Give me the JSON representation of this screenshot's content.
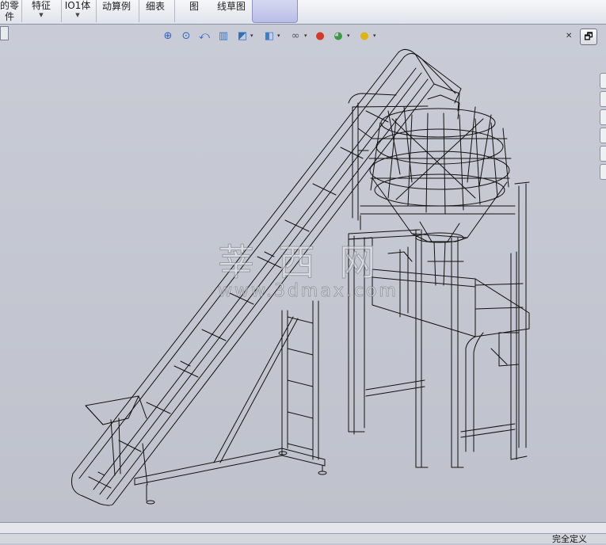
{
  "ribbon": {
    "items": [
      {
        "line1": "的零",
        "line2": "件",
        "dropdown": false
      },
      {
        "line1": "特征",
        "line2": "",
        "dropdown": true
      },
      {
        "line1": "IO1体",
        "line2": "",
        "dropdown": true
      },
      {
        "line1": "动算例",
        "line2": "",
        "dropdown": false
      },
      {
        "line1": "细表",
        "line2": "",
        "dropdown": false
      },
      {
        "line1": "图",
        "line2": "",
        "dropdown": false
      },
      {
        "line1": "线草图",
        "line2": "",
        "dropdown": false
      }
    ],
    "dropdown_glyph": "▼"
  },
  "hud_toolbar": {
    "icons": [
      {
        "name": "zoom-to-fit-icon",
        "glyph": "⊕",
        "color": "#2a62c8"
      },
      {
        "name": "zoom-to-area-icon",
        "glyph": "⊙",
        "color": "#2a62c8"
      },
      {
        "name": "previous-view-icon",
        "glyph": "⤺",
        "color": "#2a62c8"
      },
      {
        "name": "section-view-icon",
        "glyph": "▥",
        "color": "#3a78c0"
      },
      {
        "name": "view-orientation-icon",
        "glyph": "◩",
        "color": "#3070b8"
      },
      {
        "name": "display-style-icon",
        "glyph": "◧",
        "color": "#3a7ed0"
      },
      {
        "name": "hide-show-items-icon",
        "glyph": "∞",
        "color": "#555a66"
      },
      {
        "name": "edit-appearance-icon",
        "glyph": "●",
        "color": "#d43a2a"
      },
      {
        "name": "apply-scene-icon",
        "glyph": "◕",
        "color": "#3b9a44"
      },
      {
        "name": "view-settings-icon",
        "glyph": "●",
        "color": "#e0b416"
      }
    ],
    "dropdown_glyph": "▾"
  },
  "window": {
    "pin_glyph": "✕",
    "restore_glyph": "🗗"
  },
  "watermark": {
    "chinese": "莘 西 网",
    "url": "www.3dmax.com"
  },
  "status": {
    "text": "完全定义"
  },
  "colors": {
    "viewport": "#c3c6d0",
    "wire": "#111111",
    "ribbon": "#e9ecf1"
  }
}
